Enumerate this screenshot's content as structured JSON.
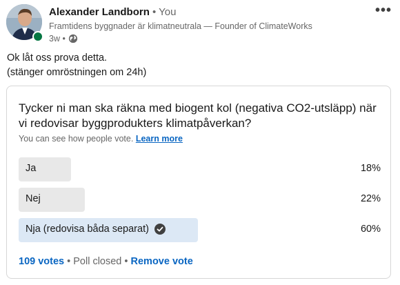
{
  "post": {
    "author_name": "Alexander Landborn",
    "author_relation": " • You",
    "headline": "Framtidens byggnader är klimatneutrala — Founder of ClimateWorks",
    "time": "3w •",
    "text_line1": "Ok låt oss prova detta.",
    "text_line2": "(stänger omröstningen om 24h)",
    "more_icon": "more-horizontal-icon",
    "visibility_icon": "globe-icon"
  },
  "poll": {
    "question": "Tycker ni man ska räkna med biogent kol (negativa CO2-utsläpp) när vi redovisar byggprodukters klimatpåverkan?",
    "visibility_note": "You can see how people vote.",
    "learn_more": "Learn more",
    "options": [
      {
        "label": "Ja",
        "percent_text": "18%",
        "percent": 18,
        "selected": false
      },
      {
        "label": "Nej",
        "percent_text": "22%",
        "percent": 22,
        "selected": false
      },
      {
        "label": "Nja (redovisa båda separat)",
        "percent_text": "60%",
        "percent": 60,
        "selected": true
      }
    ],
    "votes": "109 votes",
    "separator": " • ",
    "status": "Poll closed",
    "remove_vote": "Remove vote"
  },
  "colors": {
    "link": "#0a66c2",
    "online": "#057642",
    "bar_other": "#e8e8e8",
    "bar_selected": "#dce8f5"
  }
}
